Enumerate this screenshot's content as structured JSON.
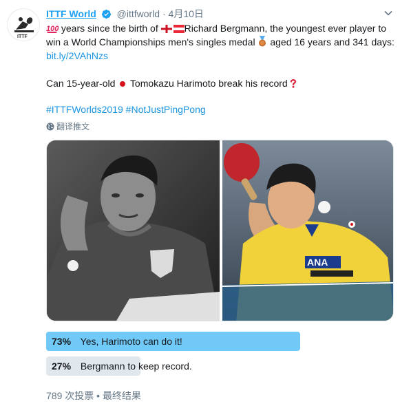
{
  "account": {
    "name": "ITTF World",
    "handle": "@ittfworld",
    "separator": "·",
    "time": "4月10日",
    "avatar_icon": "ittf-logo-icon",
    "verified_icon": "verified-badge-icon"
  },
  "tweet": {
    "line1_a": " years since the birth of ",
    "line1_b": "Richard Bergmann, the youngest ever player to",
    "line2_a": "win a World Championships men's singles medal ",
    "line2_b": " aged 16 years and 341 days:",
    "link": "bit.ly/2VAhNzs",
    "line4_a": "Can 15-year-old ",
    "line4_b": " Tomokazu Harimoto break his record",
    "hashtags": "#ITTFWorlds2019 #NotJustPingPong"
  },
  "translate": {
    "label": "翻译推文",
    "icon": "globe-icon"
  },
  "media": {
    "left_image": "Richard Bergmann black-and-white photo",
    "right_image": "Tomokazu Harimoto color photo"
  },
  "poll": {
    "options": [
      {
        "pct_label": "73%",
        "label": "Yes, Harimoto can do it!",
        "fraction": 0.73
      },
      {
        "pct_label": "27%",
        "label": "Bergmann to keep record.",
        "fraction": 0.27
      }
    ],
    "votes": "789 次投票",
    "separator": "•",
    "status": "最终结果"
  },
  "colors": {
    "accent": "#1da1f2",
    "link": "#1b95e0",
    "winning_bar": "#71c9f8",
    "other_bar": "#e1e8ed",
    "muted": "#657786"
  }
}
